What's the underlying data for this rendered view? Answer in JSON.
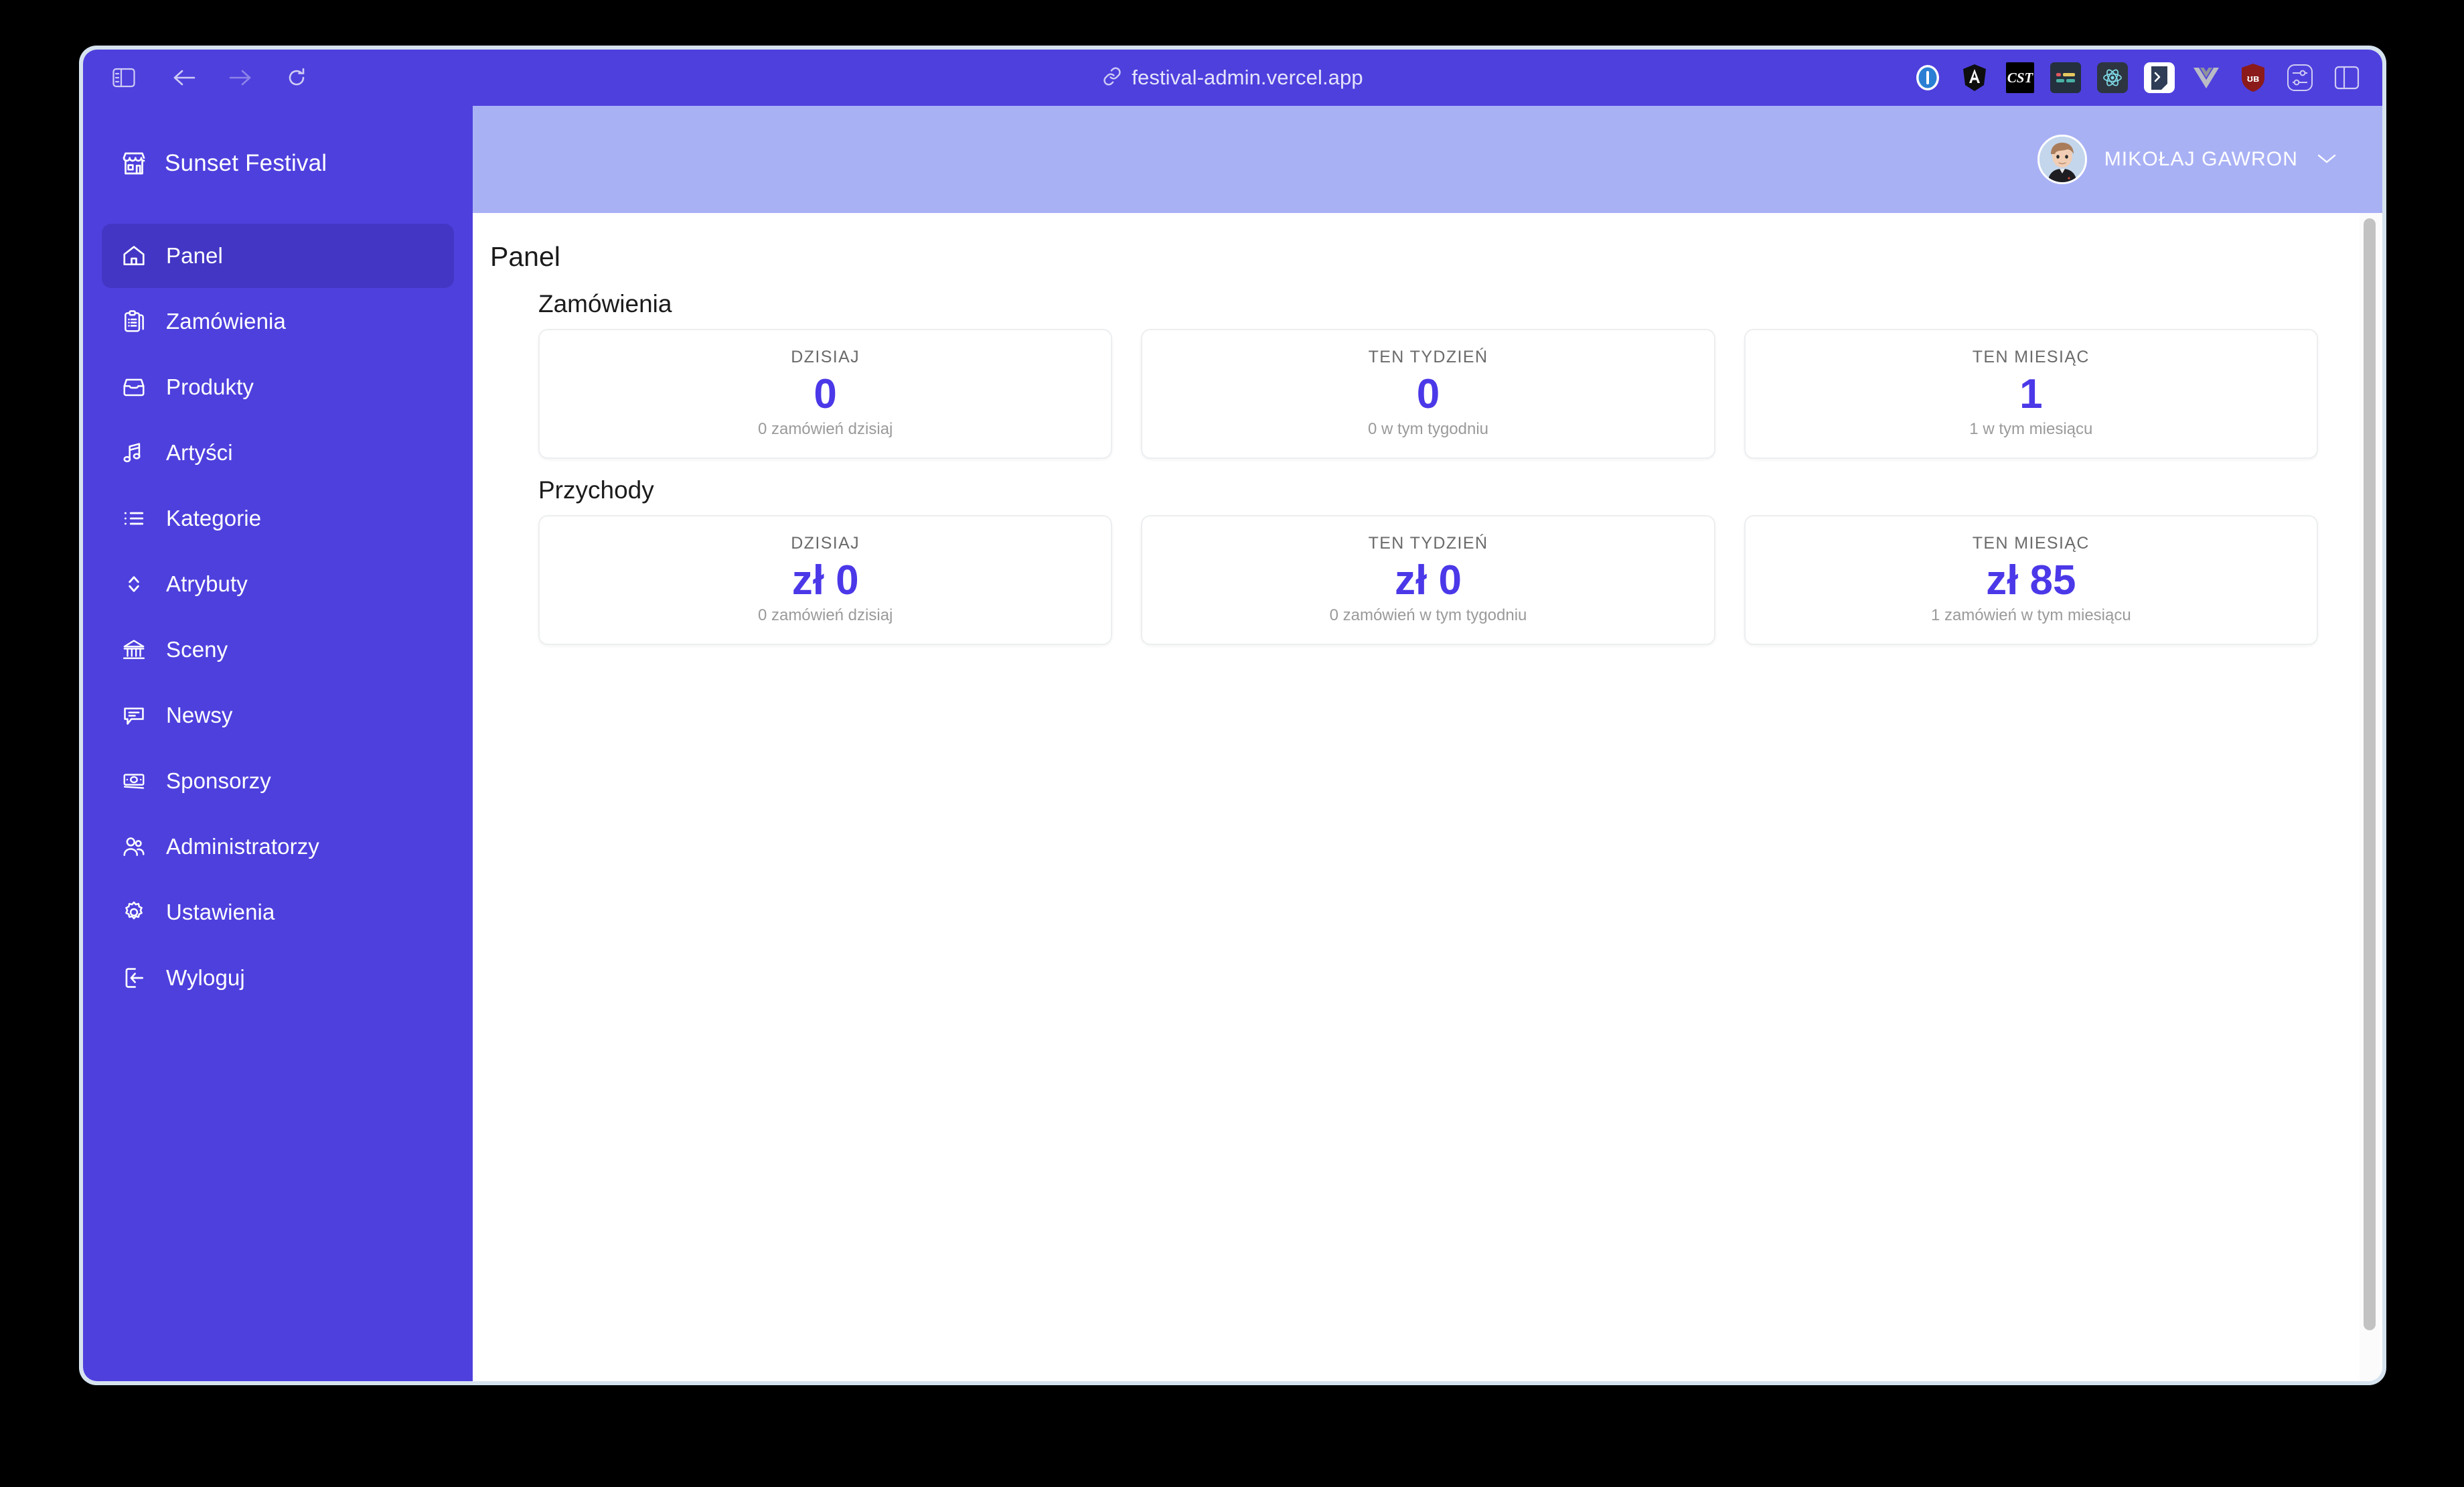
{
  "browser": {
    "url": "festival-admin.vercel.app",
    "link_icon": "link-icon",
    "nav": {
      "sidebar_toggle": "sidebar-toggle-icon",
      "back": "back-arrow-icon",
      "forward": "forward-arrow-icon",
      "reload": "reload-icon"
    },
    "extensions": [
      {
        "name": "1password-extension-icon",
        "label": ""
      },
      {
        "name": "angular-devtools-extension-icon",
        "label": ""
      },
      {
        "name": "cst-extension-icon",
        "label": "CST"
      },
      {
        "name": "card-extension-icon",
        "label": ""
      },
      {
        "name": "react-devtools-extension-icon",
        "label": ""
      },
      {
        "name": "shell-extension-icon",
        "label": ""
      },
      {
        "name": "vue-devtools-extension-icon",
        "label": ""
      },
      {
        "name": "ublock-origin-extension-icon",
        "label": ""
      },
      {
        "name": "extension-settings-icon",
        "label": ""
      },
      {
        "name": "browser-sidebar-icon",
        "label": ""
      }
    ]
  },
  "sidebar": {
    "brand": "Sunset Festival",
    "brand_icon": "storefront-icon",
    "items": [
      {
        "label": "Panel",
        "icon": "home-icon",
        "active": true
      },
      {
        "label": "Zamówienia",
        "icon": "clipboard-list-icon",
        "active": false
      },
      {
        "label": "Produkty",
        "icon": "inbox-icon",
        "active": false
      },
      {
        "label": "Artyści",
        "icon": "music-note-icon",
        "active": false
      },
      {
        "label": "Kategorie",
        "icon": "list-icon",
        "active": false
      },
      {
        "label": "Atrybuty",
        "icon": "chevron-up-down-icon",
        "active": false
      },
      {
        "label": "Sceny",
        "icon": "building-columns-icon",
        "active": false
      },
      {
        "label": "Newsy",
        "icon": "chat-bubble-icon",
        "active": false
      },
      {
        "label": "Sponsorzy",
        "icon": "banknote-icon",
        "active": false
      },
      {
        "label": "Administratorzy",
        "icon": "users-icon",
        "active": false
      },
      {
        "label": "Ustawienia",
        "icon": "gear-icon",
        "active": false
      },
      {
        "label": "Wyloguj",
        "icon": "logout-icon",
        "active": false
      }
    ]
  },
  "topbar": {
    "user_name": "MIKOŁAJ GAWRON",
    "avatar": "user-avatar",
    "chevron": "chevron-down-icon"
  },
  "main": {
    "page_title": "Panel",
    "sections": [
      {
        "title": "Zamówienia",
        "cards": [
          {
            "label": "DZISIAJ",
            "value": "0",
            "sub": "0 zamówień dzisiaj"
          },
          {
            "label": "TEN TYDZIEŃ",
            "value": "0",
            "sub": "0 w tym tygodniu"
          },
          {
            "label": "TEN MIESIĄC",
            "value": "1",
            "sub": "1 w tym miesiącu"
          }
        ]
      },
      {
        "title": "Przychody",
        "cards": [
          {
            "label": "DZISIAJ",
            "value": "zł 0",
            "sub": "0 zamówień dzisiaj"
          },
          {
            "label": "TEN TYDZIEŃ",
            "value": "zł 0",
            "sub": "0 zamówień w tym tygodniu"
          },
          {
            "label": "TEN MIESIĄC",
            "value": "zł 85",
            "sub": "1 zamówień w tym miesiącu"
          }
        ]
      }
    ]
  },
  "colors": {
    "brand_primary": "#4e40dd",
    "sidebar_active": "#4336c4",
    "topbar": "#a9b1f5",
    "accent_number": "#4b38e8",
    "card_border": "#eceef0",
    "muted_text": "#9a9a9a"
  }
}
